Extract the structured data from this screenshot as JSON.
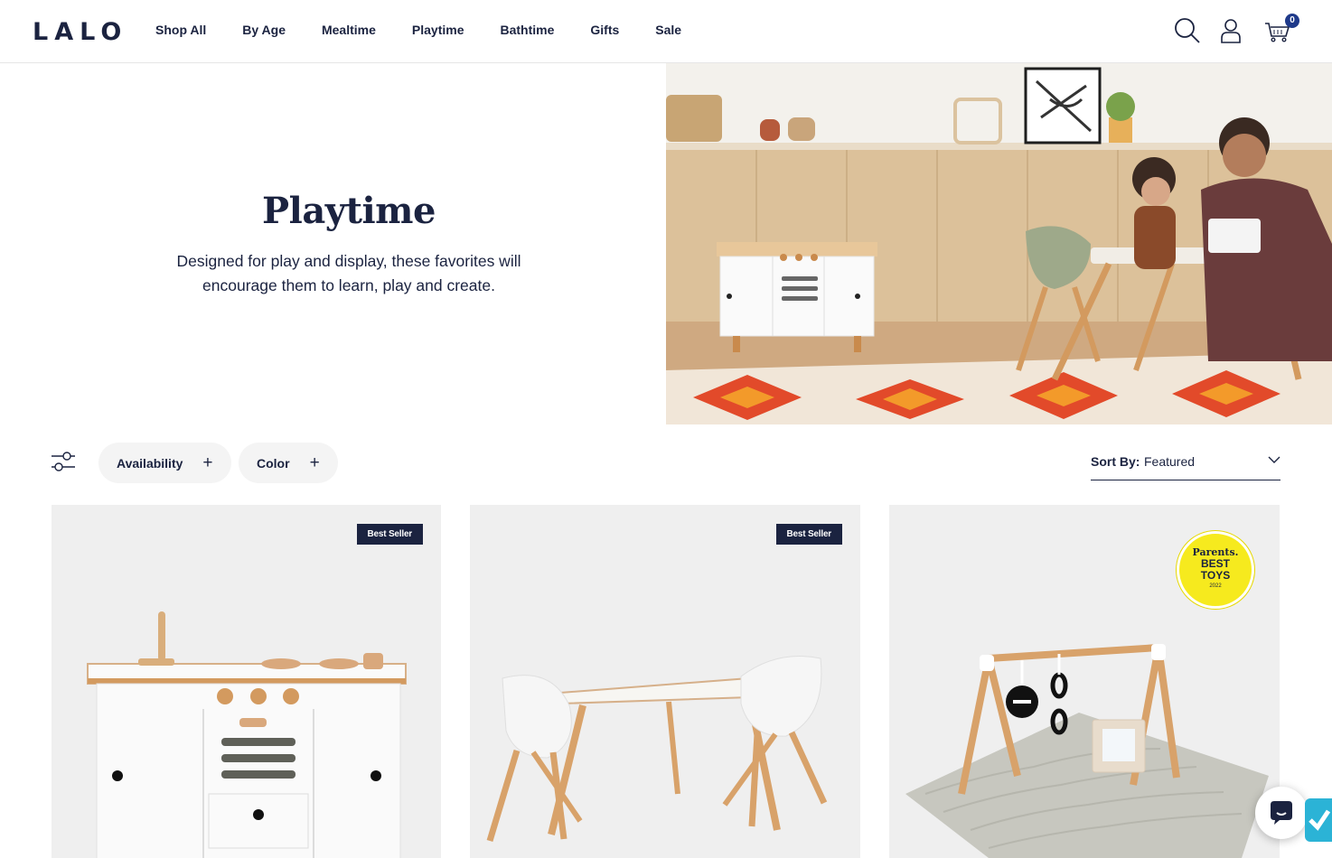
{
  "header": {
    "logo": "LALO",
    "nav": [
      "Shop All",
      "By Age",
      "Mealtime",
      "Playtime",
      "Bathtime",
      "Gifts",
      "Sale"
    ],
    "icons": [
      "search-icon",
      "account-icon",
      "cart-icon"
    ],
    "cart_count": "0"
  },
  "hero": {
    "title": "Playtime",
    "description": "Designed for play and display, these favorites will encourage them to learn, play and create."
  },
  "filters": {
    "icon": "filter-sliders-icon",
    "items": [
      {
        "label": "Availability",
        "icon": "plus"
      },
      {
        "label": "Color",
        "icon": "plus"
      }
    ],
    "sort_label": "Sort By:",
    "sort_value": "Featured"
  },
  "products": [
    {
      "badge": "Best Seller",
      "image": "play-kitchen"
    },
    {
      "badge": "Best Seller",
      "image": "kids-table-and-chairs"
    },
    {
      "award": {
        "line1": "Parents.",
        "line2": "BEST",
        "line3": "TOYS",
        "line4": "2022"
      },
      "image": "play-gym"
    }
  ],
  "colors": {
    "navy": "#1b2340",
    "card_bg": "#efefef",
    "pill_bg": "#f4f4f4",
    "award_yellow": "#f6ea1e",
    "cart_badge": "#1f3a8a"
  }
}
